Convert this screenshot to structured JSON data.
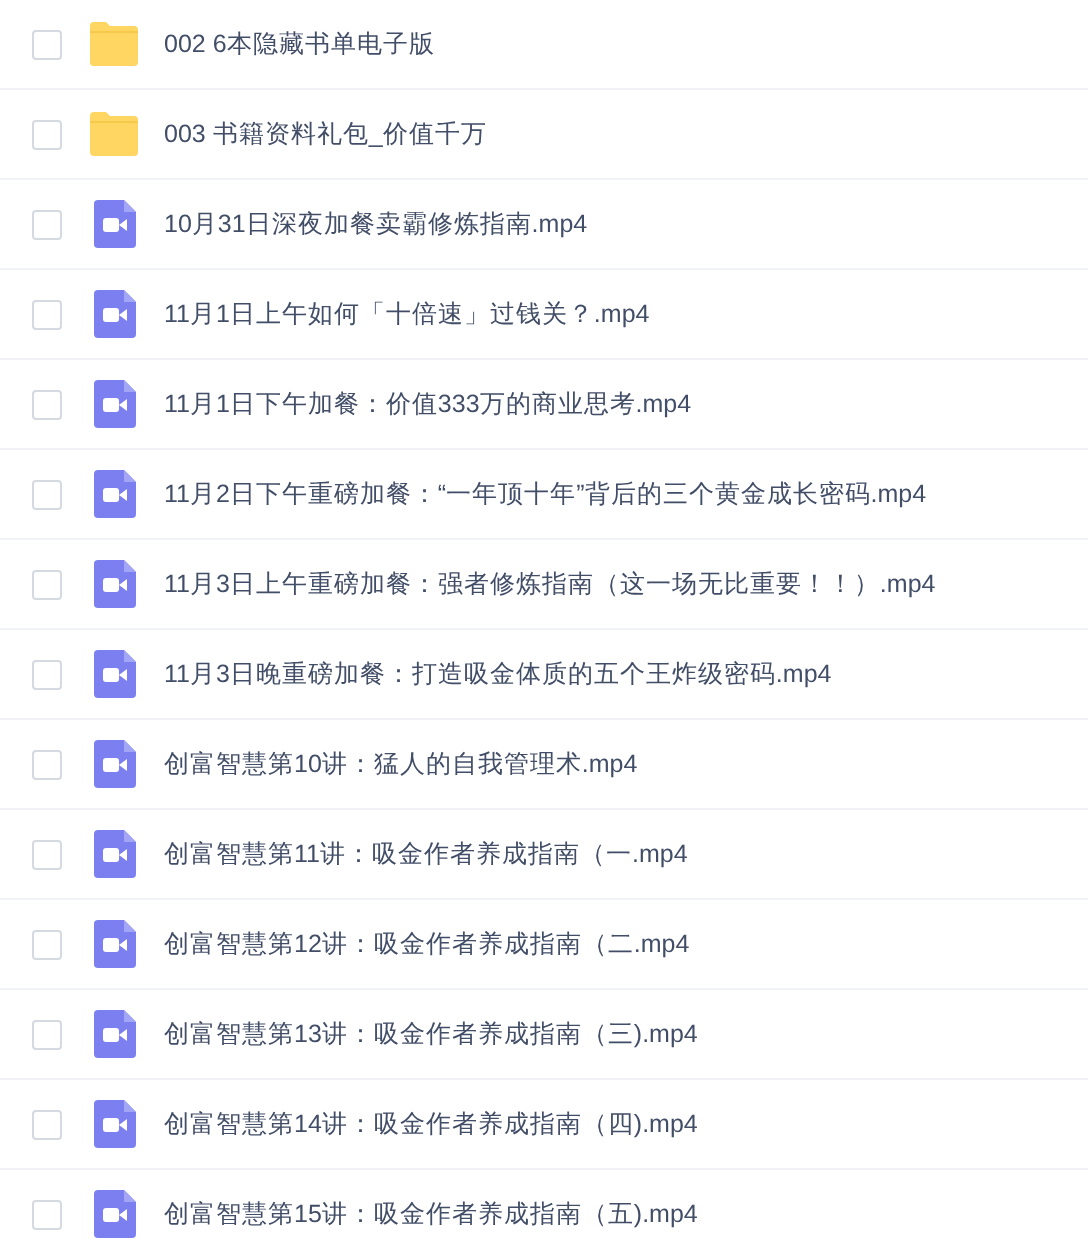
{
  "files": [
    {
      "kind": "folder",
      "name": "002 6本隐藏书单电子版",
      "checked": false
    },
    {
      "kind": "folder",
      "name": "003 书籍资料礼包_价值千万",
      "checked": false
    },
    {
      "kind": "video",
      "name": "10月31日深夜加餐卖霸修炼指南.mp4",
      "checked": false
    },
    {
      "kind": "video",
      "name": "11月1日上午如何「十倍速」过钱关？.mp4",
      "checked": false
    },
    {
      "kind": "video",
      "name": "11月1日下午加餐：价值333万的商业思考.mp4",
      "checked": false
    },
    {
      "kind": "video",
      "name": "11月2日下午重磅加餐：“一年顶十年”背后的三个黄金成长密码.mp4",
      "checked": false
    },
    {
      "kind": "video",
      "name": "11月3日上午重磅加餐：强者修炼指南（这一场无比重要！！）.mp4",
      "checked": false
    },
    {
      "kind": "video",
      "name": "11月3日晚重磅加餐：打造吸金体质的五个王炸级密码.mp4",
      "checked": false
    },
    {
      "kind": "video",
      "name": "创富智慧第10讲：猛人的自我管理术.mp4",
      "checked": false
    },
    {
      "kind": "video",
      "name": "创富智慧第11讲：吸金作者养成指南（一.mp4",
      "checked": false
    },
    {
      "kind": "video",
      "name": "创富智慧第12讲：吸金作者养成指南（二.mp4",
      "checked": false
    },
    {
      "kind": "video",
      "name": "创富智慧第13讲：吸金作者养成指南（三).mp4",
      "checked": false
    },
    {
      "kind": "video",
      "name": "创富智慧第14讲：吸金作者养成指南（四).mp4",
      "checked": false
    },
    {
      "kind": "video",
      "name": "创富智慧第15讲：吸金作者养成指南（五).mp4",
      "checked": false
    }
  ]
}
